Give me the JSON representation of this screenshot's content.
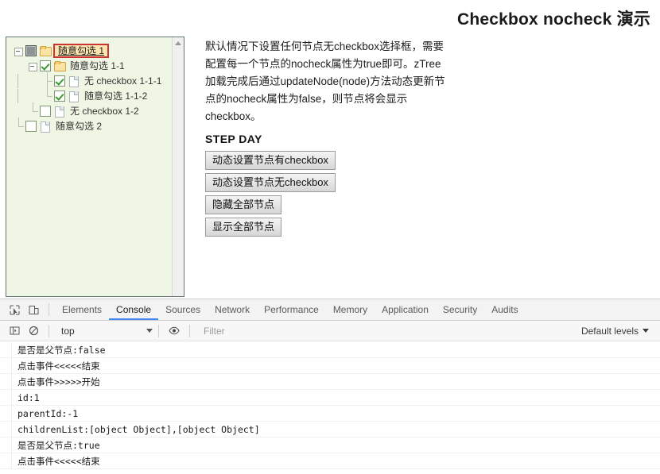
{
  "page": {
    "title": "Checkbox nocheck 演示",
    "description": "默认情况下设置任何节点无checkbox选择框，需要配置每一个节点的nocheck属性为true即可。zTree加载完成后通过updateNode(node)方法动态更新节点的nocheck属性为false，则节点将会显示checkbox。",
    "steps_title": "STEP DAY",
    "buttons": [
      {
        "label": "动态设置节点有checkbox"
      },
      {
        "label": "动态设置节点无checkbox"
      },
      {
        "label": "隐藏全部节点"
      },
      {
        "label": "显示全部节点"
      }
    ]
  },
  "tree": {
    "background": "#f0f6e4",
    "selected_highlight": "#ffe6b0",
    "selected_border": "#cc3333",
    "nodes": [
      {
        "label": "随意勾选 1",
        "level": 0,
        "switch": "minus",
        "checkbox": "part",
        "icon": "folder",
        "selected": true
      },
      {
        "label": "随意勾选 1-1",
        "level": 1,
        "switch": "minus",
        "checkbox": "checked",
        "icon": "folder",
        "selected": false
      },
      {
        "label": "无 checkbox 1-1-1",
        "level": 2,
        "switch": "tee",
        "checkbox": "checked",
        "icon": "doc",
        "selected": false
      },
      {
        "label": "随意勾选 1-1-2",
        "level": 2,
        "switch": "elbow",
        "checkbox": "checked",
        "icon": "doc",
        "selected": false
      },
      {
        "label": "无 checkbox 1-2",
        "level": 1,
        "switch": "elbow",
        "checkbox": "empty",
        "icon": "doc",
        "selected": false
      },
      {
        "label": "随意勾选 2",
        "level": 0,
        "switch": "elbow",
        "checkbox": "empty",
        "icon": "doc",
        "selected": false
      }
    ]
  },
  "devtools": {
    "accent": "#4285f4",
    "tabs": [
      {
        "label": "Elements",
        "active": false
      },
      {
        "label": "Console",
        "active": true
      },
      {
        "label": "Sources",
        "active": false
      },
      {
        "label": "Network",
        "active": false
      },
      {
        "label": "Performance",
        "active": false
      },
      {
        "label": "Memory",
        "active": false
      },
      {
        "label": "Application",
        "active": false
      },
      {
        "label": "Security",
        "active": false
      },
      {
        "label": "Audits",
        "active": false
      }
    ],
    "filterbar": {
      "context": "top",
      "filter_placeholder": "Filter",
      "filter_value": "",
      "levels": "Default levels"
    },
    "console_logs": [
      {
        "text": "是否是父节点:false"
      },
      {
        "text": "点击事件<<<<<结束"
      },
      {
        "text": "点击事件>>>>>开始"
      },
      {
        "text": "id:1"
      },
      {
        "text": "parentId:-1"
      },
      {
        "text": "childrenList:[object Object],[object Object]"
      },
      {
        "text": "是否是父节点:true"
      },
      {
        "text": "点击事件<<<<<结束"
      }
    ]
  }
}
